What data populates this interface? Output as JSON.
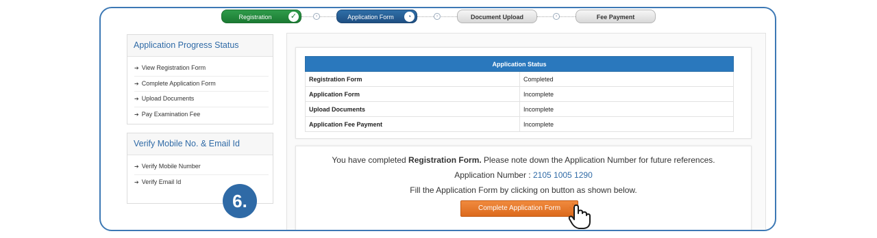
{
  "stepper": {
    "steps": [
      {
        "label": "Registration",
        "state": "done"
      },
      {
        "label": "Application Form",
        "state": "active"
      },
      {
        "label": "Document Upload",
        "state": "todo"
      },
      {
        "label": "Fee Payment",
        "state": "todo"
      }
    ]
  },
  "sidebar": {
    "progress_title": "Application Progress Status",
    "progress_items": [
      "View Registration Form",
      "Complete Application Form",
      "Upload Documents",
      "Pay Examination Fee"
    ],
    "verify_title": "Verify Mobile No. & Email Id",
    "verify_items": [
      "Verify Mobile Number",
      "Verify Email Id"
    ]
  },
  "status_table": {
    "header": "Application Status",
    "rows": [
      {
        "item": "Registration Form",
        "status": "Completed"
      },
      {
        "item": "Application Form",
        "status": "Incomplete"
      },
      {
        "item": "Upload Documents",
        "status": "Incomplete"
      },
      {
        "item": "Application Fee Payment",
        "status": "Incomplete"
      }
    ]
  },
  "message": {
    "line1_prefix": "You have completed ",
    "line1_bold": "Registration Form.",
    "line1_suffix": " Please note down the Application Number for future references.",
    "appno_label": "Application Number : ",
    "appno_value": "2105 1005 1290",
    "line3": "Fill the Application Form by clicking on button as shown below.",
    "button_label": "Complete Application Form"
  },
  "step_marker": "6.",
  "colors": {
    "brand_blue": "#2f6aa6",
    "header_blue": "#2a78bd",
    "cta_orange": "#e4752a",
    "done_green": "#1b7a33"
  }
}
